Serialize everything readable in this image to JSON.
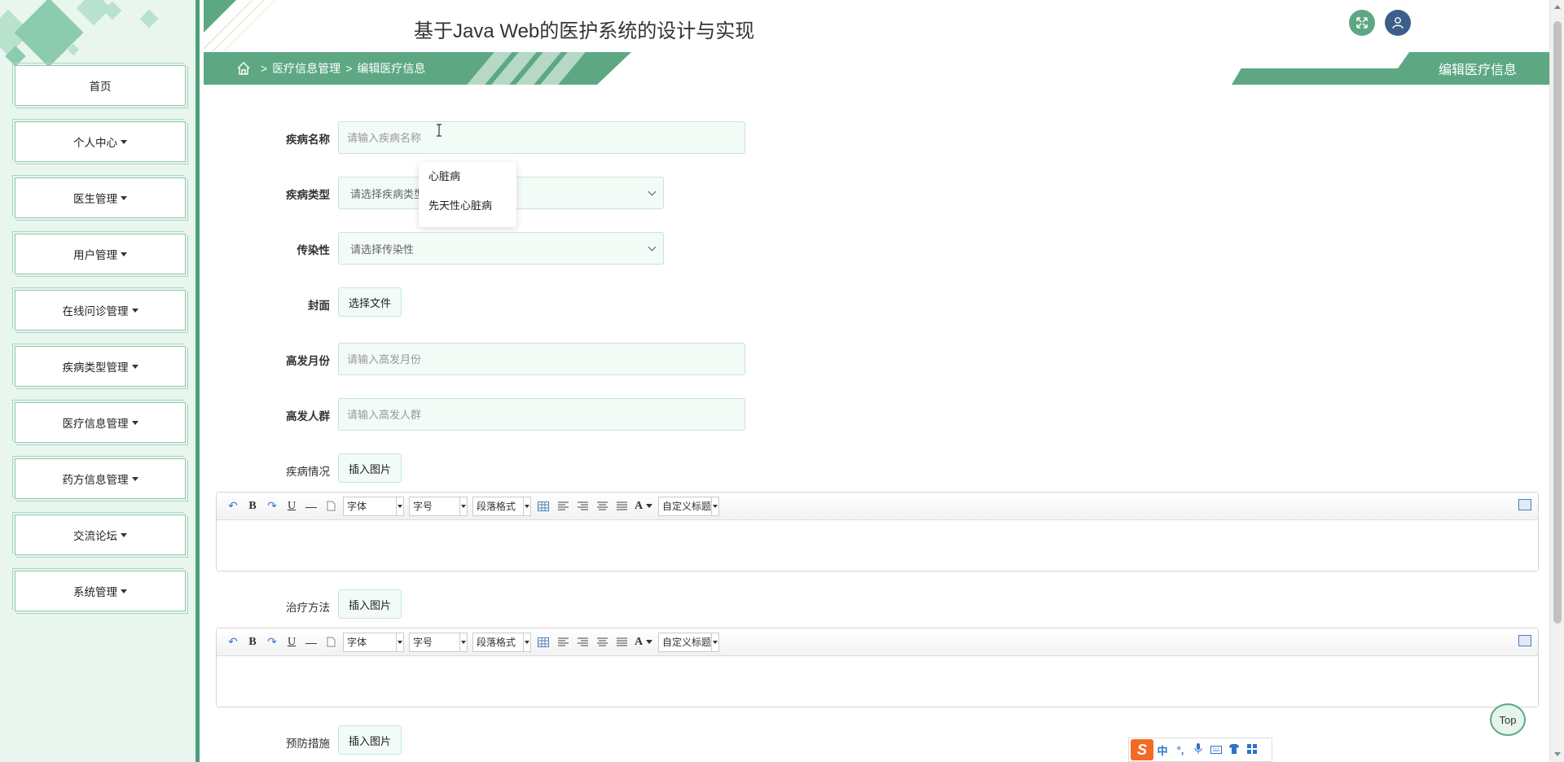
{
  "header": {
    "title": "基于Java Web的医护系统的设计与实现",
    "fullscreen_icon": "fullscreen-icon",
    "user_icon": "user-icon"
  },
  "breadcrumb": {
    "separator": ">",
    "items": [
      "医疗信息管理",
      "编辑医疗信息"
    ],
    "page_title": "编辑医疗信息"
  },
  "sidebar": {
    "items": [
      {
        "label": "首页",
        "has_caret": false
      },
      {
        "label": "个人中心",
        "has_caret": true
      },
      {
        "label": "医生管理",
        "has_caret": true
      },
      {
        "label": "用户管理",
        "has_caret": true
      },
      {
        "label": "在线问诊管理",
        "has_caret": true
      },
      {
        "label": "疾病类型管理",
        "has_caret": true
      },
      {
        "label": "医疗信息管理",
        "has_caret": true
      },
      {
        "label": "药方信息管理",
        "has_caret": true
      },
      {
        "label": "交流论坛",
        "has_caret": true
      },
      {
        "label": "系统管理",
        "has_caret": true
      }
    ]
  },
  "form": {
    "disease_name": {
      "label": "疾病名称",
      "placeholder": "请输入疾病名称",
      "value": ""
    },
    "autocomplete": [
      "心脏病",
      "先天性心脏病"
    ],
    "disease_type": {
      "label": "疾病类型",
      "placeholder": "请选择疾病类型"
    },
    "contagious": {
      "label": "传染性",
      "placeholder": "请选择传染性"
    },
    "cover": {
      "label": "封面",
      "button": "选择文件"
    },
    "peak_month": {
      "label": "高发月份",
      "placeholder": "请输入高发月份"
    },
    "high_risk_group": {
      "label": "高发人群",
      "placeholder": "请输入高发人群"
    },
    "condition": {
      "label": "疾病情况",
      "button": "插入图片"
    },
    "treatment": {
      "label": "治疗方法",
      "button": "插入图片"
    },
    "prevention": {
      "label": "预防措施",
      "button": "插入图片"
    }
  },
  "editor_toolbar": {
    "font": "字体",
    "size": "字号",
    "paragraph": "段落格式",
    "custom_title": "自定义标题",
    "bold": "B",
    "underline": "U",
    "dash": "—",
    "font_color": "A"
  },
  "top_button": "Top",
  "ime": {
    "lang": "中"
  },
  "colors": {
    "accent": "#5da883",
    "sidebar_bg": "#e8f6ef",
    "input_bg": "#f3fbf7",
    "user_btn": "#3b5f8a"
  }
}
